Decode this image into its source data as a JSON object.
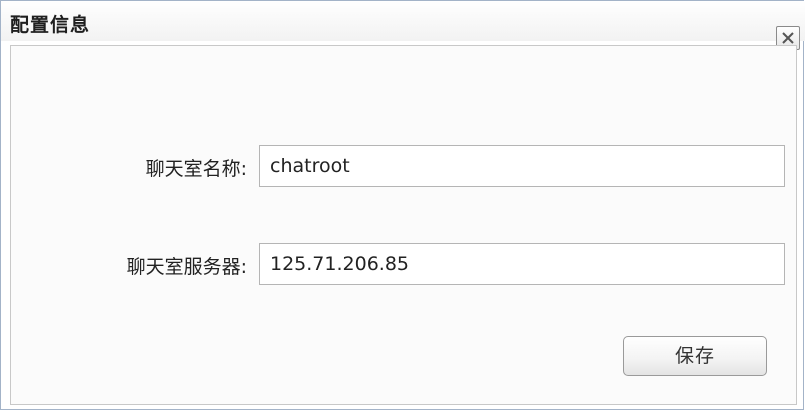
{
  "dialog": {
    "title": "配置信息",
    "close_icon": "close-icon"
  },
  "form": {
    "room_name_label": "聊天室名称:",
    "room_name_value": "chatroot",
    "server_label": "聊天室服务器:",
    "server_value": "125.71.206.85",
    "save_label": "保存"
  }
}
